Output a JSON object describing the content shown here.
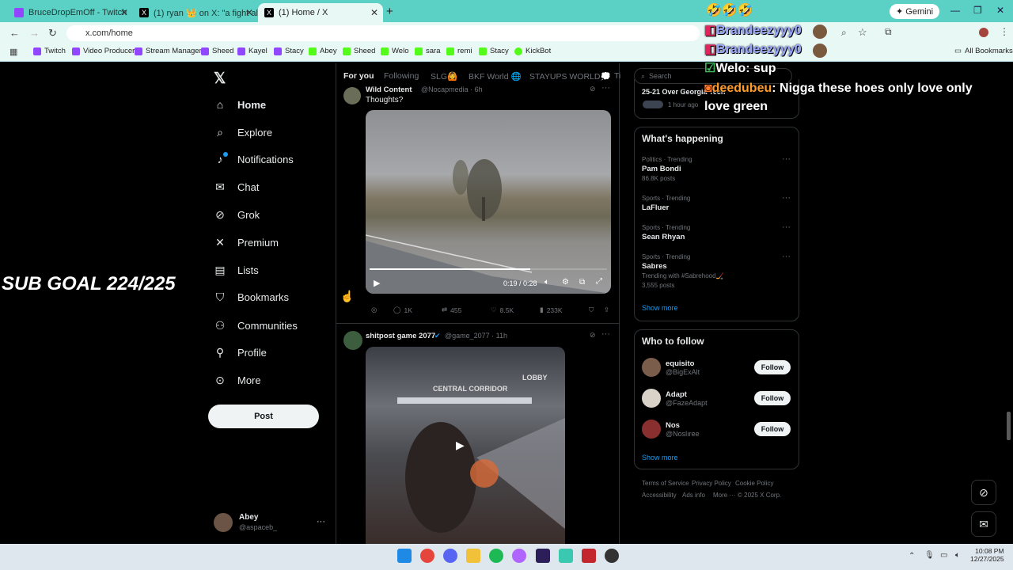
{
  "browser": {
    "tabs": [
      {
        "label": "BruceDropEmOff - Twitch"
      },
      {
        "label": "(1) ryan 👑 on X: \"a fight almos"
      },
      {
        "label": "(1) Home / X"
      }
    ],
    "url": "x.com/home",
    "gemini_label": "Gemini",
    "bookmarks": [
      "Twitch",
      "Video Producer",
      "Stream Manager",
      "Sheed",
      "Kayel",
      "Stacy",
      "Abey",
      "Sheed",
      "Welo",
      "sara",
      "remi",
      "Stacy",
      "KickBot"
    ],
    "all_bookmarks": "All Bookmarks"
  },
  "x": {
    "nav": [
      {
        "label": "Home",
        "icon": "home-icon"
      },
      {
        "label": "Explore",
        "icon": "search-icon"
      },
      {
        "label": "Notifications",
        "icon": "bell-icon"
      },
      {
        "label": "Chat",
        "icon": "mail-icon"
      },
      {
        "label": "Grok",
        "icon": "grok-icon"
      },
      {
        "label": "Premium",
        "icon": "x-icon"
      },
      {
        "label": "Lists",
        "icon": "list-icon"
      },
      {
        "label": "Bookmarks",
        "icon": "bookmark-icon"
      },
      {
        "label": "Communities",
        "icon": "people-icon"
      },
      {
        "label": "Profile",
        "icon": "person-icon"
      },
      {
        "label": "More",
        "icon": "more-icon"
      }
    ],
    "post_button": "Post",
    "account": {
      "name": "Abey",
      "handle": "@aspaceb_"
    },
    "timeline_tabs": [
      "For you",
      "Following",
      "SLG🙆",
      "BKF World 🌐",
      "STAYUPS WORLD💭",
      "Ti"
    ],
    "post1": {
      "author": "Wild Content",
      "handle": "@Nocapmedia · 6h",
      "text": "Thoughts?",
      "video_time": "0:19 / 0:28",
      "replies": "1K",
      "reposts": "455",
      "likes": "8.5K",
      "views": "233K"
    },
    "post2": {
      "author": "shitpost game 2077",
      "handle": "@game_2077 · 11h",
      "video_signs": [
        "CENTRAL CORRIDOR",
        "LOBBY"
      ]
    },
    "search_placeholder": "Search",
    "top_card_text": "25-21 Over Georgia Tech",
    "top_card_meta": "1 hour ago",
    "whats_happening": {
      "title": "What's happening",
      "trends": [
        {
          "context": "Politics · Trending",
          "name": "Pam Bondi",
          "posts": "86.8K posts"
        },
        {
          "context": "Sports · Trending",
          "name": "LaFluer",
          "posts": ""
        },
        {
          "context": "Sports · Trending",
          "name": "Sean Rhyan",
          "posts": ""
        },
        {
          "context": "Sports · Trending",
          "name": "Sabres",
          "extra": "Trending with #Sabrehood🏒",
          "posts": "3,555 posts"
        }
      ],
      "show_more": "Show more"
    },
    "who_to_follow": {
      "title": "Who to follow",
      "users": [
        {
          "name": "equisito",
          "handle": "@BigExAlt"
        },
        {
          "name": "Adapt",
          "handle": "@FazeAdapt"
        },
        {
          "name": "Nos",
          "handle": "@Noslıree"
        }
      ],
      "follow_label": "Follow",
      "show_more": "Show more"
    },
    "footer": [
      "Terms of Service",
      "Privacy Policy",
      "Cookie Policy",
      "Accessibility",
      "Ads info",
      "More ···",
      "© 2025 X Corp."
    ]
  },
  "overlay": {
    "emojis": "🤣🤣🤣",
    "chat": [
      {
        "user": "Brandeezyyy0",
        "msg": "",
        "color": "#9aa8ff"
      },
      {
        "user": "Brandeezyyy0",
        "msg": "",
        "color": "#9aa8ff"
      },
      {
        "user": "Welo",
        "msg": ": sup",
        "color": "#ffffff"
      },
      {
        "user": "deedubeu",
        "msg": ": Nigga these hoes only love only love green",
        "color": "#ff9c2a"
      }
    ],
    "sub_goal": "SUB GOAL 224/225"
  },
  "system": {
    "time": "10:08 PM",
    "date": "12/27/2025"
  },
  "colors": {
    "tabbar": "#5bd0c4",
    "x_blue": "#1d9bf0",
    "bg": "#000000"
  }
}
